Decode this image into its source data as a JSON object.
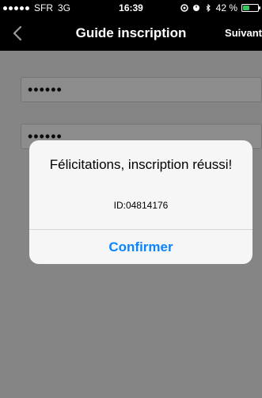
{
  "status_bar": {
    "carrier": "SFR",
    "network": "3G",
    "time": "16:39",
    "battery_text": "42 %",
    "battery_level": 0.42
  },
  "navigation": {
    "title": "Guide inscription",
    "next_label": "Suivant"
  },
  "form": {
    "field_1_value": "••••••",
    "field_2_value": "••••••"
  },
  "dialog": {
    "title": "Félicitations, inscription réussi!",
    "id_text": "ID:04814176",
    "confirm_label": "Confirmer"
  },
  "colors": {
    "nav_background": "#000000",
    "primary_blue": "#0a84ff",
    "overlay": "#000000"
  }
}
